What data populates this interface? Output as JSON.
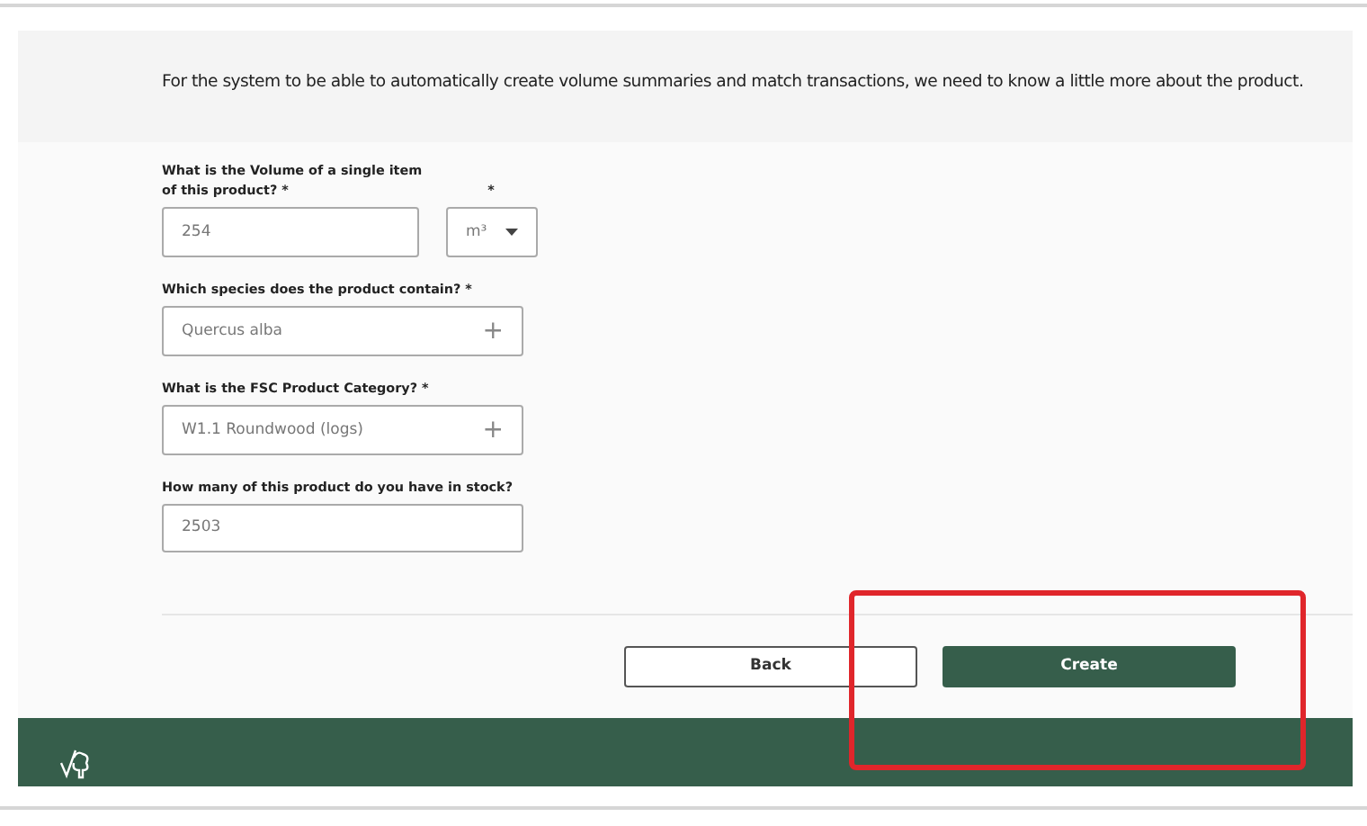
{
  "intro": "For the system to be able to automatically create volume summaries and match transactions, we need to know a little more about the product.",
  "volume": {
    "label": "What is the Volume of a single item of this product? *",
    "value": "254",
    "unit_label": "*",
    "unit": "m³"
  },
  "species": {
    "label": "Which species does the product contain? *",
    "value": "Quercus alba",
    "add": "+"
  },
  "category": {
    "label": "What is the FSC Product Category? *",
    "value": "W1.1 Roundwood (logs)",
    "add": "+"
  },
  "stock": {
    "label": "How many of this product do you have in stock?",
    "value": "2503"
  },
  "buttons": [
    {
      "label": "Back",
      "kind": "secondary"
    },
    {
      "label": "Create",
      "kind": "primary"
    }
  ]
}
